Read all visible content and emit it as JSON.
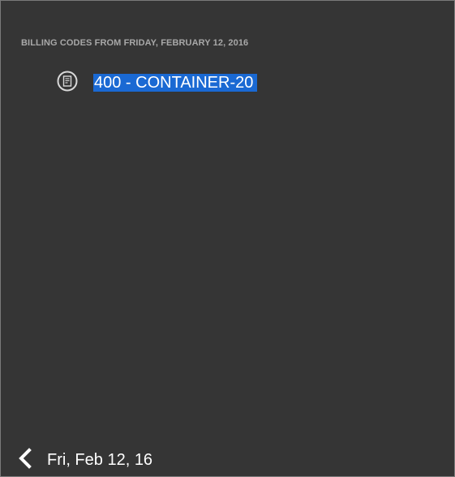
{
  "header": {
    "title": "BILLING CODES FROM FRIDAY, FEBRUARY 12, 2016"
  },
  "billing_codes": [
    {
      "label": "400 - CONTAINER-20",
      "icon": "document-icon",
      "selected": true
    }
  ],
  "footer": {
    "date_label": "Fri, Feb 12, 16",
    "back_icon": "chevron-left-icon"
  },
  "colors": {
    "background": "#353535",
    "header_text": "#a8a8a8",
    "selection": "#1a69d3",
    "text": "#ffffff"
  }
}
